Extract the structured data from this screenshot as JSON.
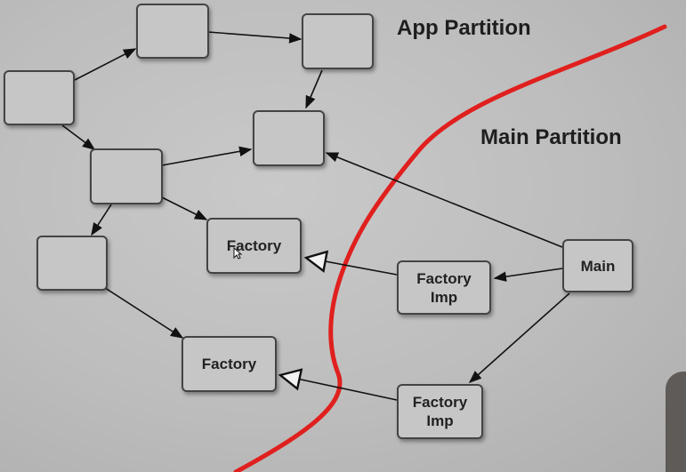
{
  "titles": {
    "app_partition": "App Partition",
    "main_partition": "Main Partition"
  },
  "nodes": {
    "factory_upper": "Factory",
    "factory_lower": "Factory",
    "factory_imp_upper": "Factory\nImp",
    "factory_imp_lower": "Factory\nImp",
    "main": "Main"
  },
  "colors": {
    "partition_line": "#e0201e",
    "edge": "#111111",
    "box_border": "#444444"
  }
}
